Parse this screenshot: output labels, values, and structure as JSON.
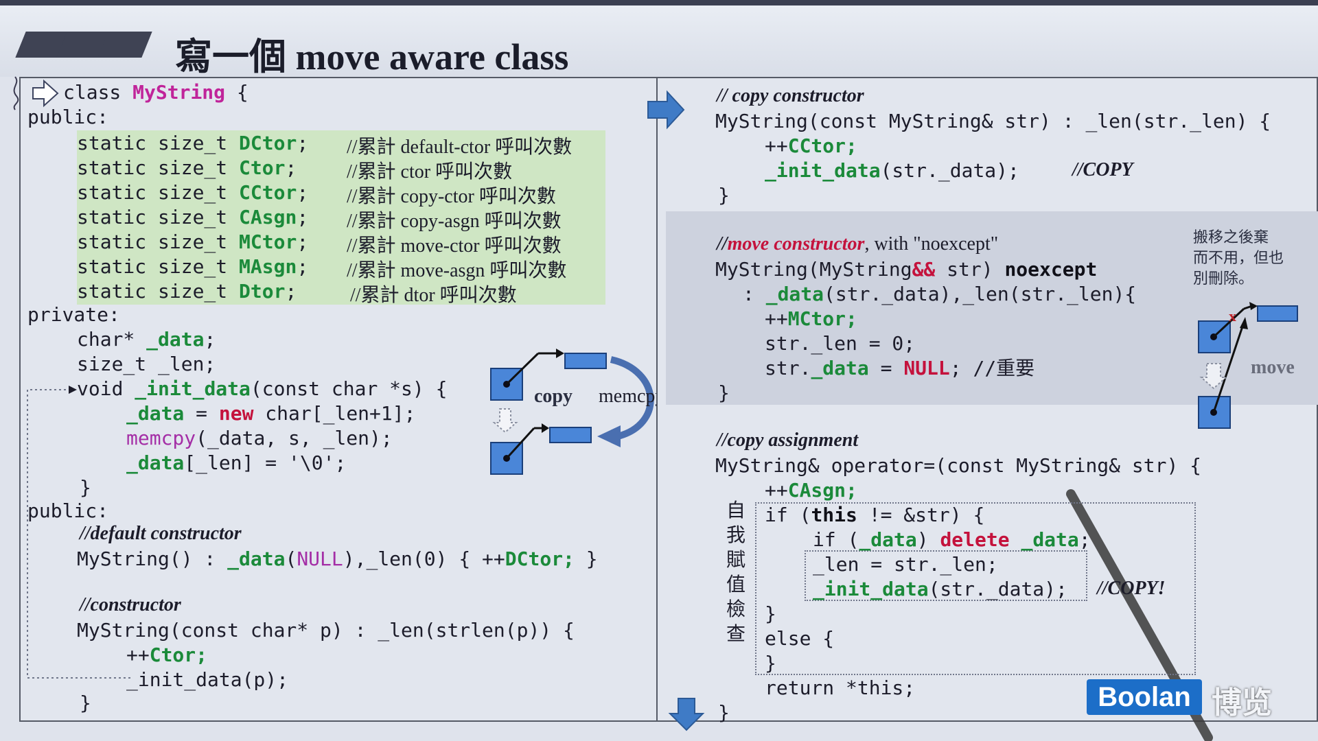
{
  "slide": {
    "title": "寫一個 move aware class"
  },
  "left_code": {
    "class_line_kw": "class ",
    "class_name": "MyString",
    "class_brace": " {",
    "public1": "public:",
    "counters": [
      {
        "type": "static size_t ",
        "name": "DCtor",
        "semi": ";",
        "comment": "//累計 default-ctor 呼叫次數"
      },
      {
        "type": "static size_t ",
        "name": "Ctor",
        "semi": ";",
        "comment": "//累計 ctor 呼叫次數"
      },
      {
        "type": "static size_t ",
        "name": "CCtor",
        "semi": ";",
        "comment": "//累計 copy-ctor 呼叫次數"
      },
      {
        "type": "static size_t ",
        "name": "CAsgn",
        "semi": ";",
        "comment": "//累計 copy-asgn 呼叫次數"
      },
      {
        "type": "static size_t ",
        "name": "MCtor",
        "semi": ";",
        "comment": "//累計 move-ctor 呼叫次數"
      },
      {
        "type": "static size_t ",
        "name": "MAsgn",
        "semi": ";",
        "comment": "//累計 move-asgn 呼叫次數"
      },
      {
        "type": "static size_t ",
        "name": "Dtor",
        "semi": ";",
        "comment": "//累計 dtor 呼叫次數"
      }
    ],
    "private": "private:",
    "member_data_type": "char* ",
    "member_data_name": "_data",
    "member_data_semi": ";",
    "member_len": "size_t _len;",
    "init_void": "void ",
    "init_name": "_init_data",
    "init_params": "(const char *s) {",
    "init_l1_var": "_data",
    "init_l1_mid": " = ",
    "init_l1_new": "new",
    "init_l1_end": " char[_len+1];",
    "init_l2_fn": "memcpy",
    "init_l2_rest": "(_data, s, _len);",
    "init_l3_var": "_data",
    "init_l3_rest": "[_len] = '\\0';",
    "init_close": "}",
    "public2": "public:",
    "default_ctor_comment": "//default constructor",
    "default_ctor_a": "MyString() : ",
    "default_ctor_data": "_data",
    "default_ctor_paren": "(",
    "default_ctor_null": "NULL",
    "default_ctor_mid": "),_len(0) { ++",
    "default_ctor_dctor": "DCtor;",
    "default_ctor_end": " }",
    "ctor_comment": "//constructor",
    "ctor_sig": "MyString(const char* p) : _len(strlen(p)) {",
    "ctor_inc_pre": "++",
    "ctor_inc_name": "Ctor;",
    "ctor_call": "_init_data(p);",
    "ctor_close": "}"
  },
  "diagram": {
    "copy_label": "copy",
    "memcpy_label": "memcpy()"
  },
  "right_code": {
    "copy_ctor_comment": "// copy constructor",
    "copy_ctor_sig": "MyString(const MyString& str) : _len(str._len) {",
    "copy_ctor_inc_pre": "++",
    "copy_ctor_inc_name": "CCtor;",
    "copy_ctor_call_fn": "_init_data",
    "copy_ctor_call_rest": "(str._data);",
    "copy_ctor_call_cmt": "//COPY",
    "copy_ctor_close": "}",
    "move_ctor_comment_prefix": "//",
    "move_ctor_comment_em": "move constructor",
    "move_ctor_comment_rest": ", with \"noexcept\"",
    "move_ctor_sig_a": "MyString(MyString",
    "move_ctor_sig_ref": "&&",
    "move_ctor_sig_b": " str) ",
    "move_ctor_noexcept": "noexcept",
    "move_ctor_init_a": ": ",
    "move_ctor_init_data": "_data",
    "move_ctor_init_rest": "(str._data),_len(str._len){",
    "move_ctor_inc_pre": "++",
    "move_ctor_inc_name": "MCtor;",
    "move_ctor_len_reset": "str._len = 0;",
    "move_ctor_data_a": "str.",
    "move_ctor_data_b": "_data",
    "move_ctor_data_c": " = ",
    "move_ctor_data_null": "NULL",
    "move_ctor_data_d": "; //重要",
    "move_ctor_close": "}",
    "move_note": "搬移之後棄而不用，但也別刪除。",
    "move_note_l1": "搬移之後棄",
    "move_note_l2": "而不用，但也",
    "move_note_l3": "別刪除。",
    "move_label": "move",
    "move_x": "x",
    "copy_asgn_comment": "//copy assignment",
    "copy_asgn_sig": "MyString& operator=(const MyString& str) {",
    "copy_asgn_inc_pre": "++",
    "copy_asgn_inc_name": "CAsgn;",
    "self_check_label": [
      "自",
      "我",
      "賦",
      "值",
      "檢",
      "查"
    ],
    "if_a": "if (",
    "if_this": "this",
    "if_b": " != &str) {",
    "if_data_a": "if (",
    "if_data_var": "_data",
    "if_data_b": ") ",
    "if_data_del": "delete",
    "if_data_c": " ",
    "if_data_var2": "_data",
    "if_data_d": ";",
    "len_assign": "_len = str._len;",
    "init_call_fn": "_init_data",
    "init_call_rest": "(str._data);",
    "init_call_cmt": "//COPY!",
    "if_close": "}",
    "else_open": "else {",
    "else_close": "}",
    "return_stmt": "return *this;",
    "final_close": "}"
  },
  "branding": {
    "logo_text": "Boolan",
    "logo_cn": "博览"
  }
}
